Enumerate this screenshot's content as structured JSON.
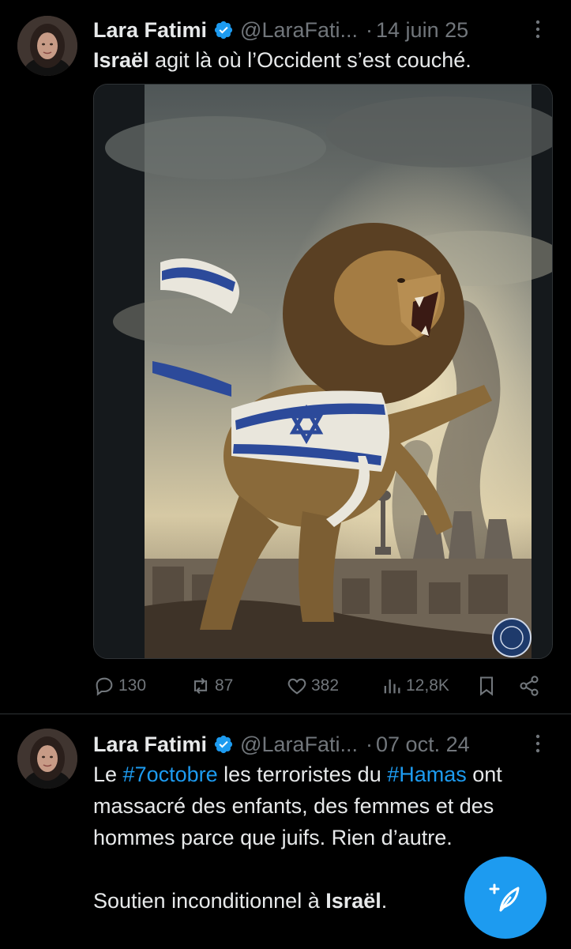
{
  "tweets": [
    {
      "author": "Lara Fatimi",
      "handle": "@LaraFati...",
      "dot": "·",
      "date": "14 juin 25",
      "text": {
        "bold": "Israël",
        "rest": " agit là où l’Occident s’est couché."
      },
      "stats": {
        "replies": "130",
        "reposts": "87",
        "likes": "382",
        "views": "12,8K"
      }
    },
    {
      "author": "Lara Fatimi",
      "handle": "@LaraFati...",
      "dot": "·",
      "date": "07 oct. 24",
      "text": {
        "p1_a": "Le ",
        "hashtag1": "#7octobre",
        "p1_b": " les terroristes du ",
        "hashtag2": "#Hamas",
        "p1_c": " ont massacré des enfants, des femmes et des hommes parce que juifs. Rien d’autre.",
        "p2_a": "Soutien inconditionnel à ",
        "p2_bold": "Israël",
        "p2_b": "."
      }
    }
  ],
  "media": {
    "logo_text": "NANTES ENSEMBLE"
  },
  "colors": {
    "accent": "#1d9bf0",
    "muted": "#71767b",
    "text": "#e7e9ea",
    "background": "#000000"
  },
  "icons": {
    "verified": "verified-badge-icon",
    "reply": "reply-icon",
    "repost": "repost-icon",
    "like": "heart-icon",
    "views": "views-icon",
    "bookmark": "bookmark-icon",
    "share": "share-icon",
    "compose": "compose-post-icon"
  }
}
